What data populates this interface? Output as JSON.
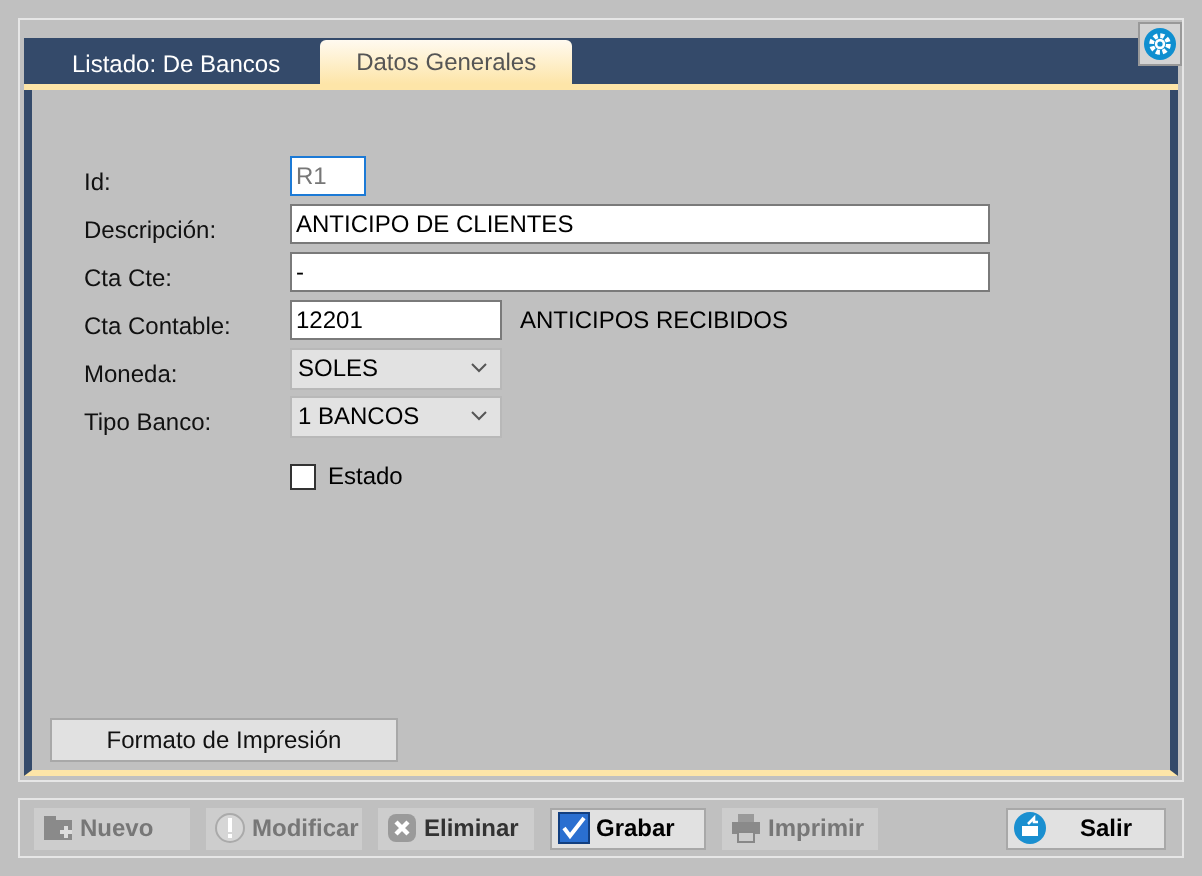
{
  "tabs": [
    {
      "label": "Listado: De Bancos",
      "selected": false
    },
    {
      "label": "Datos Generales",
      "selected": true
    }
  ],
  "fields": [
    {
      "label": "Id:",
      "kind": "text",
      "value": "R1",
      "focused": true,
      "read_only": true
    },
    {
      "label": "Descripción:",
      "kind": "text",
      "value": "ANTICIPO DE CLIENTES",
      "focused": false,
      "read_only": false
    },
    {
      "label": "Cta Cte:",
      "kind": "text",
      "value": "-",
      "focused": false,
      "read_only": false
    },
    {
      "label": "Cta Contable:",
      "kind": "text",
      "value": "12201",
      "focused": false,
      "read_only": false,
      "note": "ANTICIPOS RECIBIDOS"
    },
    {
      "label": "Moneda:",
      "kind": "combo",
      "value": "SOLES"
    },
    {
      "label": "Tipo Banco:",
      "kind": "combo",
      "value": "1 BANCOS"
    },
    {
      "label": "Estado",
      "kind": "checkbox",
      "checked": false
    }
  ],
  "format_button": "Formato de Impresión",
  "toolbar": [
    {
      "label": "Nuevo",
      "disabled": true,
      "default": false
    },
    {
      "label": "Modificar",
      "disabled": true,
      "default": false
    },
    {
      "label": "Eliminar",
      "disabled": false,
      "default": false
    },
    {
      "label": "Grabar",
      "disabled": false,
      "default": true
    },
    {
      "label": "Imprimir",
      "disabled": true,
      "default": false
    },
    {
      "label": "Salir",
      "disabled": false,
      "default": true
    }
  ]
}
